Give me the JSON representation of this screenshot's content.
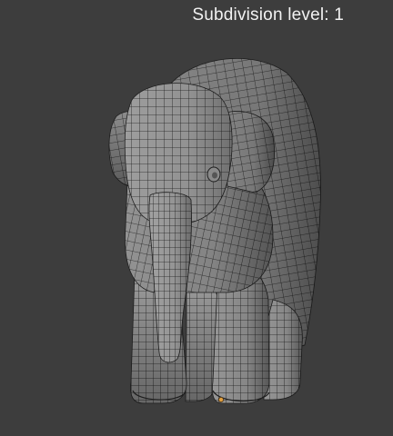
{
  "viewport": {
    "overlay": {
      "subdivision_label": "Subdivision level: 1"
    },
    "model": {
      "name": "elephant-wireframe-mesh",
      "shading": "wireframe-on-solid"
    }
  },
  "colors": {
    "background": "#3d3d3d",
    "mesh_fill": "#a3a3a3",
    "mesh_shadow": "#707070",
    "wire": "#1f1f1f",
    "origin_marker": "#e0a040",
    "overlay_text": "#f2f2f2"
  }
}
